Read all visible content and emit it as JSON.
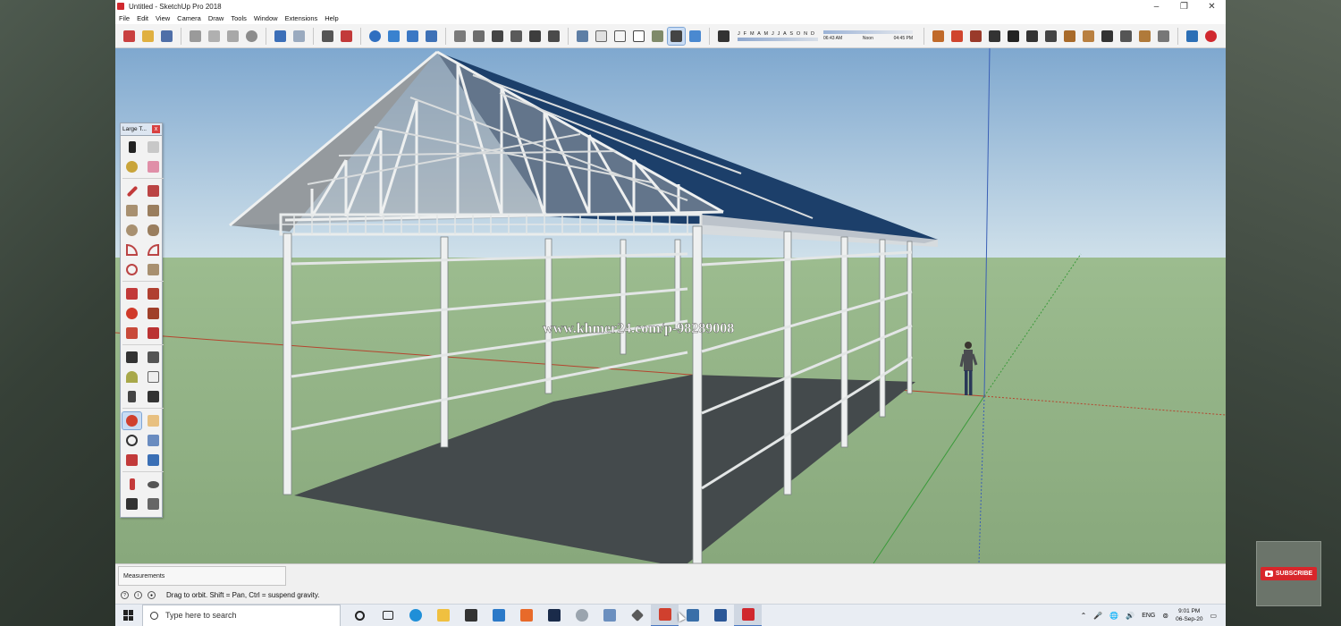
{
  "window": {
    "title": "Untitled - SketchUp Pro 2018",
    "controls": [
      "–",
      "❐",
      "✕"
    ]
  },
  "menu": [
    "File",
    "Edit",
    "View",
    "Camera",
    "Draw",
    "Tools",
    "Window",
    "Extensions",
    "Help"
  ],
  "shadow_settings": {
    "months": "J F M A M J J A S O N D",
    "time_start": "06:43 AM",
    "time_noon": "Noon",
    "time_end": "04:45 PM"
  },
  "tool_tray": {
    "title": "Large T...",
    "close": "x"
  },
  "viewport": {
    "watermark": "www.khmer24.com/p-98289008",
    "sky_color": "#a9c7e0",
    "ground_color": "#92b388",
    "roof_color": "#1c3f6a",
    "floor_shadow_color": "#444a4c"
  },
  "measurements": {
    "label": "Measurements"
  },
  "status": {
    "message": "Drag to orbit. Shift = Pan, Ctrl = suspend gravity."
  },
  "taskbar": {
    "search_placeholder": "Type here to search",
    "language": "ENG",
    "time": "9:01 PM",
    "date": "06-Sep-20"
  },
  "subscribe": {
    "label": "SUBSCRIBE"
  }
}
